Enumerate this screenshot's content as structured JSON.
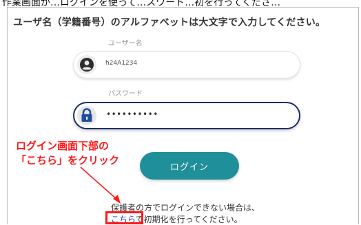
{
  "top_partial_text": "作業画面が…ログインを使って…スワード…初を行ってくださ…",
  "notice": "ユーザ名（学籍番号）のアルファベットは大文字で入力してください。",
  "username": {
    "label": "ユーザー名",
    "value": "h24A1234"
  },
  "password": {
    "label": "パスワード",
    "value": "••••••••••"
  },
  "login_button": "ログイン",
  "annotation": {
    "line1": "ログイン画面下部の",
    "line2": "「こちら」をクリック"
  },
  "guardian": {
    "line1": "保護者の方でログインできない場合は、",
    "link": "こちら",
    "line2_rest": "で初期化を行ってください。"
  },
  "colors": {
    "accent": "#1f8f9a",
    "annotation": "#ff1a1a",
    "link": "#1a3cc8"
  },
  "icons": {
    "user": "user-circle-icon",
    "lock": "lock-icon"
  }
}
